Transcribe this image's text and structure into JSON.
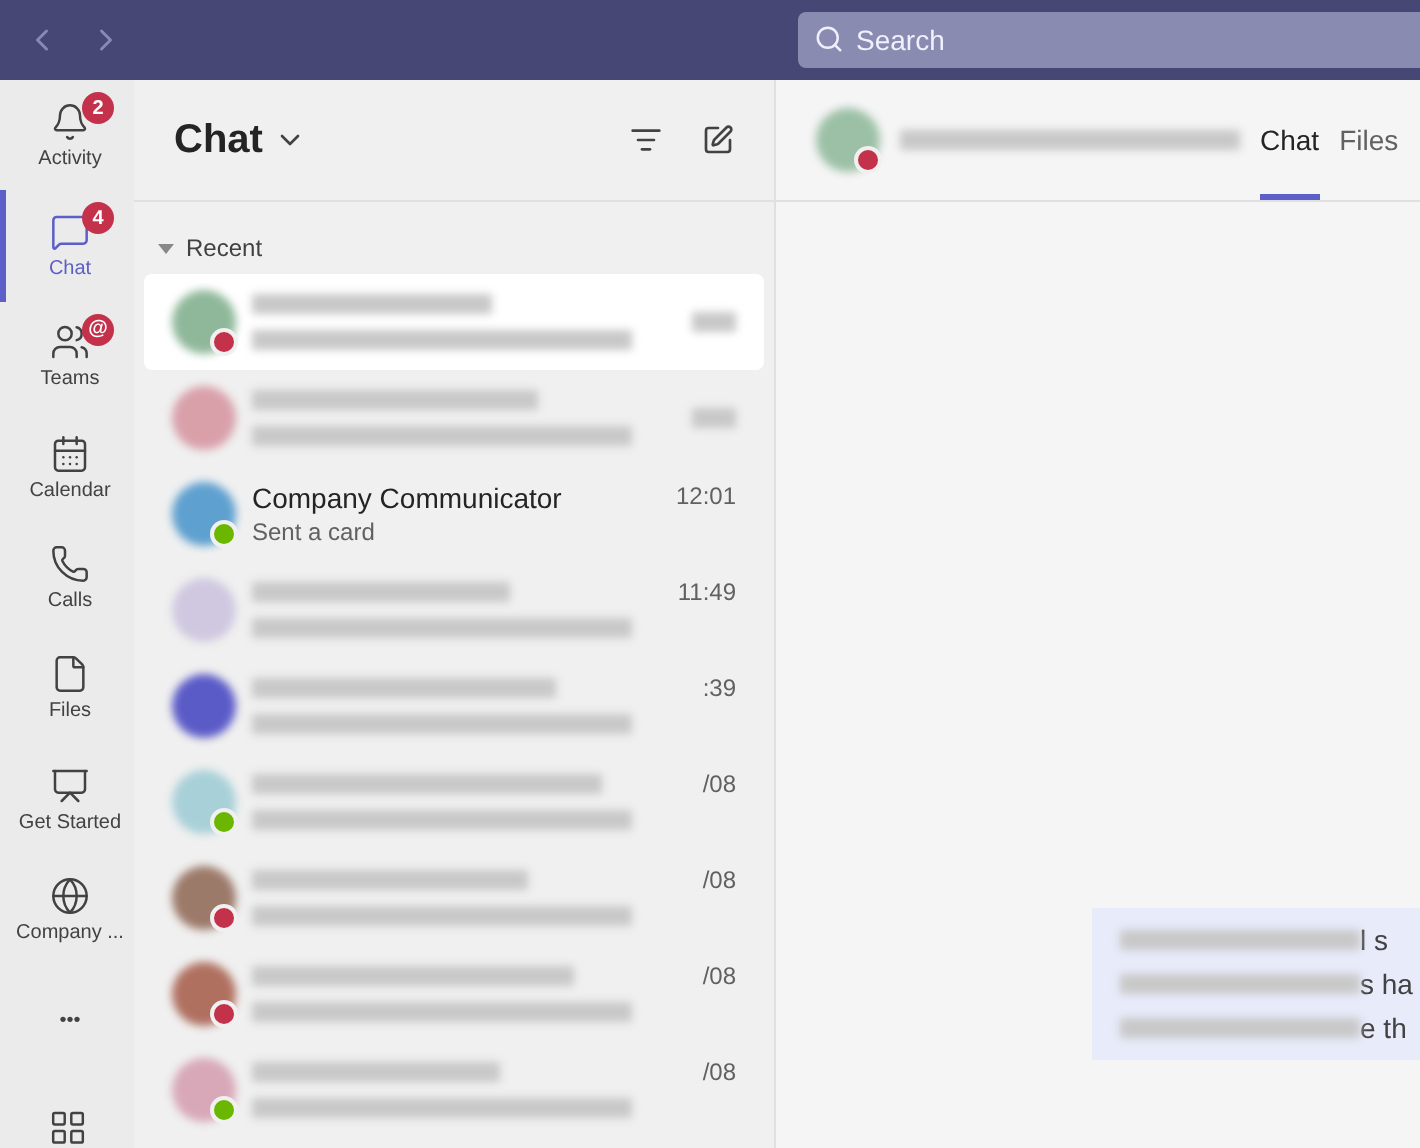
{
  "search": {
    "placeholder": "Search"
  },
  "rail": [
    {
      "label": "Activity",
      "badge": "2",
      "selected": false
    },
    {
      "label": "Chat",
      "badge": "4",
      "selected": true
    },
    {
      "label": "Teams",
      "badge": "@",
      "selected": false
    },
    {
      "label": "Calendar",
      "selected": false
    },
    {
      "label": "Calls",
      "selected": false
    },
    {
      "label": "Files",
      "selected": false
    },
    {
      "label": "Get Started",
      "selected": false
    },
    {
      "label": "Company ...",
      "selected": false
    },
    {
      "label": "•••",
      "selected": false
    }
  ],
  "chat_list": {
    "title": "Chat",
    "section": "Recent",
    "rows": [
      {
        "selected": true,
        "color": "#8fb89a",
        "available": false
      },
      {
        "selected": false,
        "color": "#d9a0aa"
      },
      {
        "selected": false,
        "color": "#5ea0d0",
        "available": true,
        "name": "Company Communicator",
        "preview": "Sent a card",
        "time": "12:01"
      },
      {
        "selected": false,
        "color": "#cfc8e0",
        "time": "11:49"
      },
      {
        "selected": false,
        "color": "#5b5bc8",
        "time": ":39"
      },
      {
        "selected": false,
        "color": "#a8d0d8",
        "available": true,
        "time": "/08"
      },
      {
        "selected": false,
        "color": "#9c7a6a",
        "available": false,
        "time": "/08"
      },
      {
        "selected": false,
        "color": "#b07060",
        "available": false,
        "time": "/08"
      },
      {
        "selected": false,
        "color": "#d8a8b8",
        "available": true,
        "time": "/08"
      }
    ]
  },
  "conversation": {
    "tabs": [
      {
        "label": "Chat",
        "selected": true
      },
      {
        "label": "Files",
        "selected": false
      }
    ],
    "message_fragments": [
      "l s",
      "s ha",
      "e th"
    ]
  }
}
